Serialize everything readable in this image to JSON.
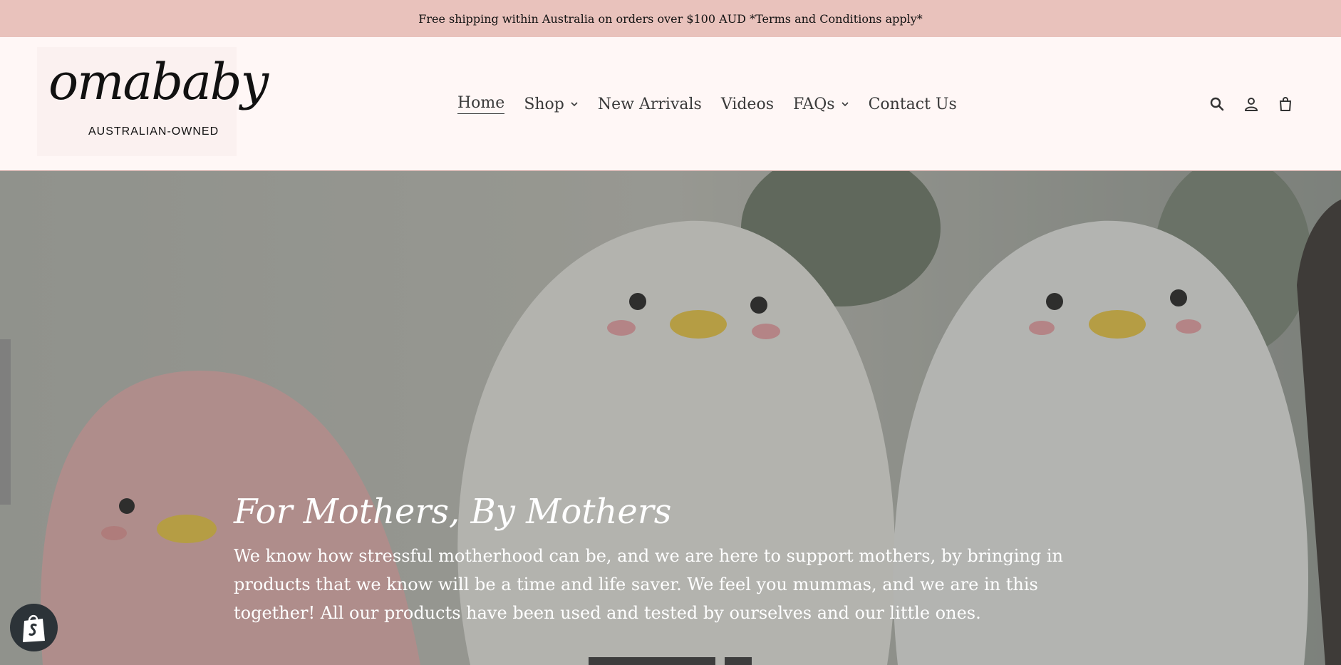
{
  "announcement": "Free shipping within Australia on orders over $100 AUD *Terms and Conditions apply*",
  "logo": {
    "name": "omababy",
    "tagline": "AUSTRALIAN-OWNED"
  },
  "nav": {
    "home": "Home",
    "shop": "Shop",
    "new_arrivals": "New Arrivals",
    "videos": "Videos",
    "faqs": "FAQs",
    "contact": "Contact Us"
  },
  "icons": [
    "search-icon",
    "account-icon",
    "cart-icon"
  ],
  "hero": {
    "title": "For Mothers, By Mothers",
    "text": "We know how stressful motherhood can be, and we are here to support mothers, by bringing in products that we know will be a time and life saver. We feel you mummas, and we are in this together! All our products have been used and tested by ourselves and our little ones."
  },
  "colors": {
    "announcement_bg": "#e9c2bc",
    "header_bg": "#fff7f6",
    "text": "#3a3a3a"
  }
}
